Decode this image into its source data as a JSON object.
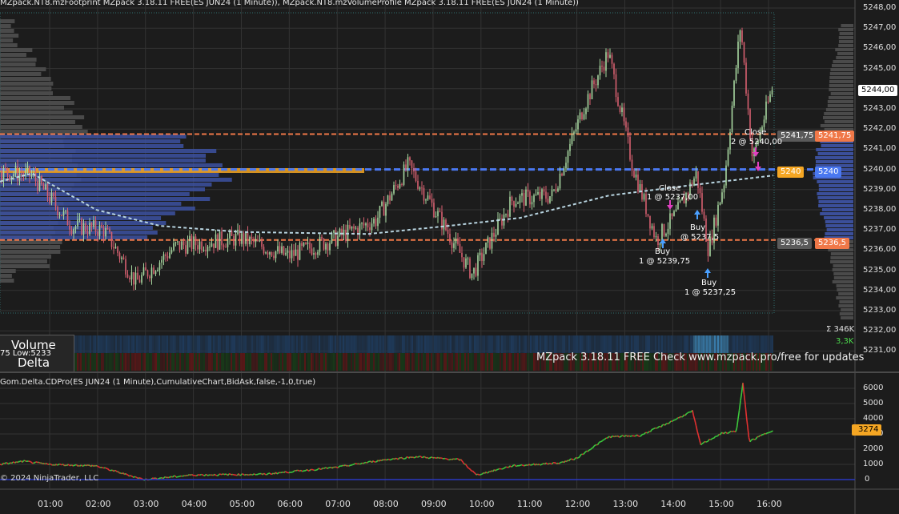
{
  "window": {
    "title": "MZpack.NT8.mzFootprint MZpack 3.18.11 FREE(ES JUN24 (1 Minute)), MZpack.NT8.mzVolumeProfile MZpack 3.18.11 FREE(ES JUN24 (1 Minute))"
  },
  "banner": "MZpack 3.18.11 FREE  Check www.mzpack.pro/free for updates",
  "volume_delta": {
    "volume_label": "Volume",
    "delta_label": "Delta",
    "low_text": "75 Low:5233",
    "sigma_text": "Σ 346K",
    "last_volume": "3,3K"
  },
  "indicator": {
    "title": "Gom.Delta.CDPro(ES JUN24 (1 Minute),CumulativeChart,BidAsk,false,-1,0,true)",
    "value_tag": "3274"
  },
  "copyright": "© 2024 NinjaTrader, LLC",
  "price_axis": {
    "ticks": [
      "5248,00",
      "5247,00",
      "5246,00",
      "5245,00",
      "5244,00",
      "5243,00",
      "5242,00",
      "5241,00",
      "5240,00",
      "5239,00",
      "5238,00",
      "5237,00",
      "5236,00",
      "5235,00",
      "5234,00",
      "5233,00",
      "5232,00",
      "5231,00"
    ],
    "current_price": "5244,00"
  },
  "delta_axis": {
    "ticks": [
      "6000",
      "5000",
      "4000",
      "3000",
      "2000",
      "1000",
      "0"
    ]
  },
  "time_axis": {
    "ticks": [
      "01:00",
      "02:00",
      "03:00",
      "04:00",
      "05:00",
      "06:00",
      "07:00",
      "08:00",
      "09:00",
      "10:00",
      "11:00",
      "12:00",
      "13:00",
      "14:00",
      "15:00",
      "16:00"
    ]
  },
  "levels": {
    "upper": {
      "label_gray": "5241,75",
      "label_orange": "5241,75",
      "price": 5241.75
    },
    "poc": {
      "label_gray": "5240",
      "label_blue": "5240",
      "price": 5240
    },
    "lower": {
      "label_gray": "5236,5",
      "label_orange": "5236,5",
      "price": 5236.5
    }
  },
  "trades": [
    {
      "side": "Buy",
      "text": "1 @ 5239,75"
    },
    {
      "side": "Close",
      "text": "1 @ 5237,00"
    },
    {
      "side": "Buy",
      "text": "@ 5237,5"
    },
    {
      "side": "Buy",
      "text": "1 @ 5237,25"
    },
    {
      "side": "Close",
      "text": "2 @ 5240,00"
    }
  ],
  "colors": {
    "background": "#1c1c1c",
    "grid": "#333333",
    "up_candle": "#a8d8a0",
    "down_candle": "#d86070",
    "profile_blue": "#3b4f9a",
    "profile_gray": "#4a4a4a",
    "level_orange": "#f07848",
    "poc_blue": "#4a78f0",
    "vwap": "#b8d4e0",
    "delta_green": "#3cc83c",
    "delta_red": "#e03030",
    "value_tag_orange": "#f5a623"
  }
}
